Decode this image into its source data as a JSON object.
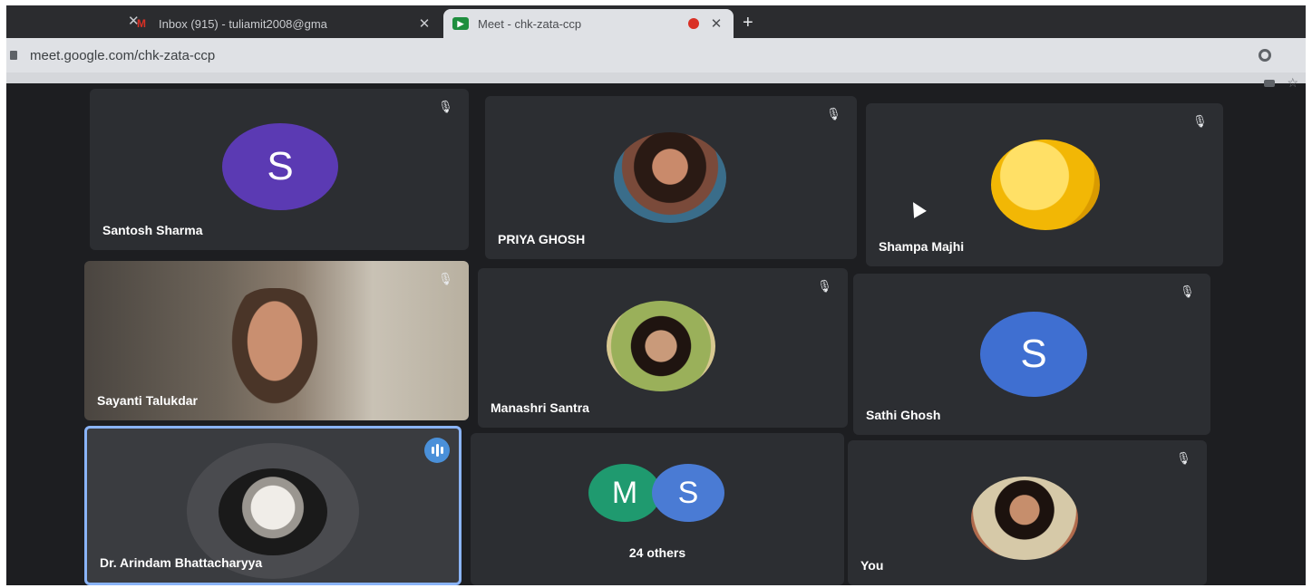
{
  "browser": {
    "tabs": [
      {
        "title": "Inbox (915) - tuliamit2008@gma",
        "icon": "gmail-icon",
        "active": false
      },
      {
        "title": "Meet - chk-zata-ccp",
        "icon": "meet-icon",
        "active": true
      }
    ],
    "close_glyph": "✕",
    "new_tab_glyph": "+",
    "url": "meet.google.com/chk-zata-ccp"
  },
  "meeting": {
    "participants": [
      {
        "name": "Santosh Sharma",
        "avatar_letter": "S",
        "avatar_color": "#5b3ab3",
        "muted": true
      },
      {
        "name": "PRIYA GHOSH",
        "avatar_type": "photo",
        "muted": true
      },
      {
        "name": "Shampa Majhi",
        "avatar_type": "emoji-photo",
        "muted": true
      },
      {
        "name": "Sayanti Talukdar",
        "avatar_type": "video",
        "muted": true
      },
      {
        "name": "Manashri Santra",
        "avatar_type": "photo",
        "muted": true
      },
      {
        "name": "Sathi Ghosh",
        "avatar_letter": "S",
        "avatar_color": "#3f6fd1",
        "muted": true
      },
      {
        "name": "Dr. Arindam Bhattacharyya",
        "avatar_type": "photo",
        "speaking": true,
        "muted": false
      },
      {
        "name": "You",
        "avatar_type": "photo",
        "muted": true
      }
    ],
    "others": {
      "avatars": [
        {
          "letter": "M",
          "color": "#1f9a6f"
        },
        {
          "letter": "S",
          "color": "#4a7bd4"
        }
      ],
      "label": "24 others"
    },
    "speaking_color": "#8ab4f8"
  }
}
